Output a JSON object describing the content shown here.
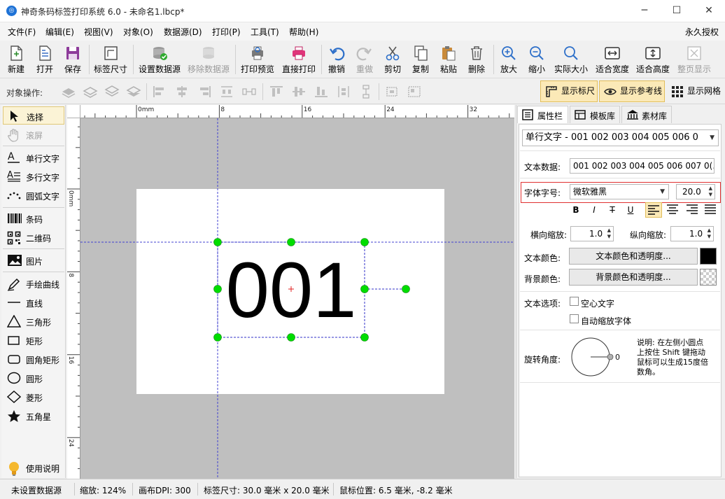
{
  "window": {
    "title": "神奇条码标签打印系统 6.0 - 未命名1.lbcp*",
    "controls": [
      "minimize-icon",
      "maximize-icon",
      "close-icon"
    ]
  },
  "menubar": {
    "items": [
      "文件(F)",
      "编辑(E)",
      "视图(V)",
      "对象(O)",
      "数据源(D)",
      "打印(P)",
      "工具(T)",
      "帮助(H)"
    ],
    "license": "永久授权"
  },
  "toolbar": {
    "buttons": [
      {
        "label": "新建",
        "icon": "new-file-icon",
        "enabled": true
      },
      {
        "label": "打开",
        "icon": "open-icon",
        "enabled": true
      },
      {
        "label": "保存",
        "icon": "save-icon",
        "enabled": true
      },
      {
        "label": "标签尺寸",
        "icon": "label-size-icon",
        "enabled": true
      },
      {
        "label": "设置数据源",
        "icon": "database-set-icon",
        "enabled": true
      },
      {
        "label": "移除数据源",
        "icon": "database-remove-icon",
        "enabled": false
      },
      {
        "label": "打印预览",
        "icon": "print-preview-icon",
        "enabled": true
      },
      {
        "label": "直接打印",
        "icon": "printer-icon",
        "enabled": true
      },
      {
        "label": "撤销",
        "icon": "undo-icon",
        "enabled": true
      },
      {
        "label": "重做",
        "icon": "redo-icon",
        "enabled": false
      },
      {
        "label": "剪切",
        "icon": "scissors-icon",
        "enabled": true
      },
      {
        "label": "复制",
        "icon": "copy-icon",
        "enabled": true
      },
      {
        "label": "粘贴",
        "icon": "paste-icon",
        "enabled": true
      },
      {
        "label": "删除",
        "icon": "trash-icon",
        "enabled": true
      },
      {
        "label": "放大",
        "icon": "zoom-in-icon",
        "enabled": true
      },
      {
        "label": "缩小",
        "icon": "zoom-out-icon",
        "enabled": true
      },
      {
        "label": "实际大小",
        "icon": "actual-size-icon",
        "enabled": true
      },
      {
        "label": "适合宽度",
        "icon": "fit-width-icon",
        "enabled": true
      },
      {
        "label": "适合高度",
        "icon": "fit-height-icon",
        "enabled": true
      },
      {
        "label": "整页显示",
        "icon": "full-page-icon",
        "enabled": false
      }
    ]
  },
  "objbar": {
    "label": "对象操作:",
    "show_ruler": "显示标尺",
    "show_guides": "显示参考线",
    "show_grid": "显示网格"
  },
  "tools": [
    {
      "label": "选择",
      "icon": "cursor-arrow-icon",
      "selected": true
    },
    {
      "label": "滚屏",
      "icon": "hand-icon",
      "enabled": false
    },
    {
      "label": "单行文字",
      "icon": "single-line-text-icon"
    },
    {
      "label": "多行文字",
      "icon": "multi-line-text-icon"
    },
    {
      "label": "圆弧文字",
      "icon": "arc-text-icon"
    },
    {
      "label": "条码",
      "icon": "barcode-icon"
    },
    {
      "label": "二维码",
      "icon": "qrcode-icon"
    },
    {
      "label": "图片",
      "icon": "image-icon"
    },
    {
      "label": "手绘曲线",
      "icon": "pen-icon"
    },
    {
      "label": "直线",
      "icon": "line-icon"
    },
    {
      "label": "三角形",
      "icon": "triangle-icon"
    },
    {
      "label": "矩形",
      "icon": "rectangle-icon"
    },
    {
      "label": "圆角矩形",
      "icon": "rounded-rect-icon"
    },
    {
      "label": "圆形",
      "icon": "circle-icon"
    },
    {
      "label": "菱形",
      "icon": "diamond-icon"
    },
    {
      "label": "五角星",
      "icon": "star-icon"
    },
    {
      "label": "使用说明",
      "icon": "lightbulb-icon"
    }
  ],
  "ruler": {
    "h_labels": [
      "0mm",
      "8",
      "16",
      "24",
      "32"
    ],
    "v_labels": [
      "0mm",
      "8",
      "16",
      "24"
    ]
  },
  "canvas": {
    "text": "001"
  },
  "rpanel": {
    "tabs": [
      "属性栏",
      "模板库",
      "素材库"
    ],
    "object_select": "单行文字 - 001 002 003 004 005 006 0",
    "text_data_label": "文本数据:",
    "text_data_value": "001 002 003 004 005 006 007 0(...",
    "font_label": "字体字号:",
    "font_name": "微软雅黑",
    "font_size": "20.0",
    "format_buttons": [
      "B",
      "I",
      "T",
      "U"
    ],
    "h_scale_label": "横向缩放:",
    "h_scale": "1.0",
    "v_scale_label": "纵向缩放:",
    "v_scale": "1.0",
    "text_color_label": "文本颜色:",
    "text_color_btn": "文本颜色和透明度...",
    "text_color": "#000000",
    "bg_color_label": "背景颜色:",
    "bg_color_btn": "背景颜色和透明度...",
    "text_options_label": "文本选项:",
    "hollow_text": "空心文字",
    "auto_shrink": "自动缩放字体",
    "rotation_label": "旋转角度:",
    "rotation_value": "0",
    "rotation_note": [
      "说明: 在左侧小圆点",
      "上按住 Shift 键拖动",
      "鼠标可以生成15度倍",
      "数角。"
    ]
  },
  "status": {
    "datasource": "未设置数据源",
    "zoom": "缩放: 124%",
    "dpi": "画布DPI: 300",
    "label_size": "标签尺寸: 30.0 毫米 x 20.0 毫米",
    "mouse_pos": "鼠标位置: 6.5 毫米, -8.2 毫米"
  },
  "colors": {
    "selection_handle": "#00dd00",
    "guide_line": "#4040d0",
    "highlight_border": "#e03030",
    "accent": "#1e72d6"
  }
}
